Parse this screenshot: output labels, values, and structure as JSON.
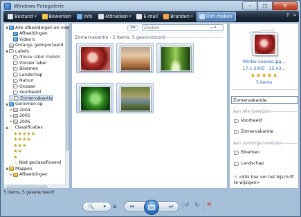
{
  "window": {
    "title": "Windows Fotogalerie",
    "caption_buttons": [
      "–",
      "□",
      "✕"
    ]
  },
  "toolbar": {
    "items": [
      {
        "label": "Bestand",
        "icon": "file-icon",
        "color": "#d9e6f3",
        "dropdown": true,
        "active": false
      },
      {
        "label": "Bewerken",
        "icon": "edit-icon",
        "color": "#f4c542",
        "dropdown": false,
        "active": false
      },
      {
        "label": "Info",
        "icon": "info-icon",
        "color": "#6fb2f0",
        "dropdown": false,
        "active": false
      },
      {
        "label": "Afdrukken",
        "icon": "printer-icon",
        "color": "#d9e1ea",
        "dropdown": true,
        "active": false
      },
      {
        "label": "E-mail",
        "icon": "email-icon",
        "color": "#e7e7e7",
        "dropdown": false,
        "active": false
      },
      {
        "label": "Branden",
        "icon": "burn-disc-icon",
        "color": "#f0a64a",
        "dropdown": true,
        "active": false
      },
      {
        "label": "Film maken",
        "icon": "film-icon",
        "color": "#c9ddf3",
        "dropdown": false,
        "active": true
      }
    ],
    "right_icons": [
      "help-icon",
      "chevron-right-icon"
    ]
  },
  "tree": [
    {
      "label": "Alle afbeeldingen en vide",
      "indent": 0,
      "expander": "▲",
      "icon": "pic"
    },
    {
      "label": "Afbeeldingen",
      "indent": 1,
      "expander": "",
      "icon": "pic"
    },
    {
      "label": "Video's",
      "indent": 1,
      "expander": "",
      "icon": "pic"
    },
    {
      "label": "Onlangs geïmporteerd",
      "indent": 0,
      "expander": "",
      "icon": "gray"
    },
    {
      "label": "Labels",
      "indent": 0,
      "expander": "▲",
      "icon": "tag"
    },
    {
      "label": "Nieuw label maken",
      "indent": 1,
      "expander": "",
      "icon": "tag",
      "italic": true
    },
    {
      "label": "Zonder label",
      "indent": 1,
      "expander": "",
      "icon": "tag"
    },
    {
      "label": "Bloemen",
      "indent": 1,
      "expander": "",
      "icon": "tag"
    },
    {
      "label": "Landschap",
      "indent": 1,
      "expander": "",
      "icon": "tag"
    },
    {
      "label": "Natuur",
      "indent": 1,
      "expander": "",
      "icon": "tag"
    },
    {
      "label": "Oceaan",
      "indent": 1,
      "expander": "",
      "icon": "tag"
    },
    {
      "label": "Voorbeeld",
      "indent": 1,
      "expander": "",
      "icon": "tag"
    },
    {
      "label": "Zomervakantie",
      "indent": 1,
      "expander": "",
      "icon": "tag",
      "selected": true
    },
    {
      "label": "Genomen op",
      "indent": 0,
      "expander": "▲",
      "icon": "pic"
    },
    {
      "label": "2004",
      "indent": 1,
      "expander": "▸",
      "icon": "gray"
    },
    {
      "label": "2005",
      "indent": 1,
      "expander": "▸",
      "icon": "gray"
    },
    {
      "label": "2006",
      "indent": 1,
      "expander": "▸",
      "icon": "gray"
    },
    {
      "label": "Classificaties",
      "indent": 0,
      "expander": "▲",
      "icon": "star"
    },
    {
      "label": "★★★★★",
      "indent": 1,
      "expander": "",
      "icon": "none",
      "stars": true
    },
    {
      "label": "★★★★",
      "indent": 1,
      "expander": "",
      "icon": "none",
      "stars": true
    },
    {
      "label": "★★★",
      "indent": 1,
      "expander": "",
      "icon": "none",
      "stars": true
    },
    {
      "label": "★★",
      "indent": 1,
      "expander": "",
      "icon": "none",
      "stars": true
    },
    {
      "label": "★",
      "indent": 1,
      "expander": "",
      "icon": "none",
      "stars": true
    },
    {
      "label": "Niet geclassificeerd",
      "indent": 1,
      "expander": "",
      "icon": "star"
    },
    {
      "label": "Mappen",
      "indent": 0,
      "expander": "▲",
      "icon": "fold"
    },
    {
      "label": "Afbeeldingen",
      "indent": 1,
      "expander": "▸",
      "icon": "fold"
    }
  ],
  "view": {
    "button": "⊞▾",
    "search_placeholder": "Zoeken"
  },
  "group_header": "Zomervakantie - 5 items, 5 geselecteerd",
  "thumbnails": [
    {
      "name": "winter-leaves-thumb",
      "img": "img1"
    },
    {
      "name": "desert-thumb",
      "img": "img2"
    },
    {
      "name": "forest-thumb",
      "img": "img3"
    },
    {
      "name": "green-plant-thumb",
      "img": "img4"
    },
    {
      "name": "stream-thumb",
      "img": "img5"
    }
  ],
  "info": {
    "file_name": "Winter Leaves.jpg...",
    "date": "17-1-2005",
    "time": "15:43...",
    "rating": "★★★★★",
    "count": "5 items",
    "tag_input": "Zomervakantie",
    "section_all": "Aan alle toewijzen",
    "tags_all": [
      "Voorbeeld",
      "Zomervakantie"
    ],
    "section_some": "Aan sommige toewijzen",
    "tags_some": [
      "Bloemen",
      "Landschap"
    ],
    "add_caption": "<Klik hier om het bijschrift te wijzigen>"
  },
  "status": "5 items, 5 geselecteerd",
  "controls": {
    "zoom": "🔍",
    "prev": "⏮",
    "next": "⏭",
    "rotate_ccw": "↺",
    "rotate_cw": "↻",
    "delete": "✕",
    "grid": "⊞"
  }
}
